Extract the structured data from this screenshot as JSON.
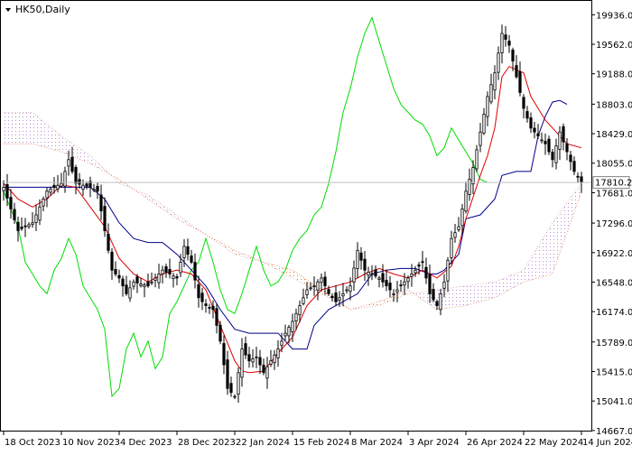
{
  "chart_title": "HK50,Daily",
  "chart_data": {
    "type": "candlestick",
    "symbol": "HK50",
    "timeframe": "Daily",
    "indicator": "Ichimoku Kinko Hyo",
    "current_price": 17810.2,
    "current_price_label": "17810.2",
    "y_range": [
      14677,
      20100
    ],
    "y_ticks": [
      {
        "label": "19936.0",
        "value": 19936.0
      },
      {
        "label": "19562.0",
        "value": 19562.0
      },
      {
        "label": "19188.0",
        "value": 19188.0
      },
      {
        "label": "18803.0",
        "value": 18803.0
      },
      {
        "label": "18429.0",
        "value": 18429.0
      },
      {
        "label": "18055.0",
        "value": 18055.0
      },
      {
        "label": "17681.0",
        "value": 17681.0
      },
      {
        "label": "17296.0",
        "value": 17296.0
      },
      {
        "label": "16922.0",
        "value": 16922.0
      },
      {
        "label": "16548.0",
        "value": 16548.0
      },
      {
        "label": "16174.0",
        "value": 16174.0
      },
      {
        "label": "15789.0",
        "value": 15789.0
      },
      {
        "label": "15415.0",
        "value": 15415.0
      },
      {
        "label": "15041.0",
        "value": 15041.0
      },
      {
        "label": "14667.0",
        "value": 14667.0
      }
    ],
    "x_ticks": [
      {
        "label": "18 Oct 2023",
        "index": 0
      },
      {
        "label": "10 Nov 2023",
        "index": 16
      },
      {
        "label": "4 Dec 2023",
        "index": 32
      },
      {
        "label": "28 Dec 2023",
        "index": 48
      },
      {
        "label": "22 Jan 2024",
        "index": 64
      },
      {
        "label": "15 Feb 2024",
        "index": 80
      },
      {
        "label": "8 Mar 2024",
        "index": 96
      },
      {
        "label": "3 Apr 2024",
        "index": 112
      },
      {
        "label": "26 Apr 2024",
        "index": 128
      },
      {
        "label": "22 May 2024",
        "index": 144
      },
      {
        "label": "14 Jun 2024",
        "index": 160
      }
    ],
    "last_candle_index": 160,
    "series": [
      {
        "name": "close",
        "color": "#000000",
        "points": [
          [
            0,
            17750
          ],
          [
            4,
            17200
          ],
          [
            8,
            17300
          ],
          [
            12,
            17700
          ],
          [
            16,
            17800
          ],
          [
            18,
            18100
          ],
          [
            20,
            17800
          ],
          [
            24,
            17750
          ],
          [
            26,
            17700
          ],
          [
            28,
            17200
          ],
          [
            30,
            16700
          ],
          [
            32,
            16600
          ],
          [
            34,
            16400
          ],
          [
            36,
            16550
          ],
          [
            40,
            16500
          ],
          [
            44,
            16700
          ],
          [
            48,
            16600
          ],
          [
            50,
            17000
          ],
          [
            52,
            16800
          ],
          [
            54,
            16350
          ],
          [
            56,
            16250
          ],
          [
            58,
            16200
          ],
          [
            60,
            15800
          ],
          [
            62,
            15200
          ],
          [
            64,
            15100
          ],
          [
            66,
            15700
          ],
          [
            68,
            15550
          ],
          [
            70,
            15600
          ],
          [
            72,
            15400
          ],
          [
            74,
            15550
          ],
          [
            76,
            15700
          ],
          [
            78,
            15900
          ],
          [
            80,
            16050
          ],
          [
            84,
            16450
          ],
          [
            86,
            16500
          ],
          [
            88,
            16600
          ],
          [
            90,
            16400
          ],
          [
            92,
            16300
          ],
          [
            96,
            16500
          ],
          [
            98,
            16950
          ],
          [
            100,
            16700
          ],
          [
            104,
            16600
          ],
          [
            108,
            16400
          ],
          [
            112,
            16600
          ],
          [
            116,
            16800
          ],
          [
            118,
            16400
          ],
          [
            120,
            16250
          ],
          [
            122,
            16550
          ],
          [
            124,
            17100
          ],
          [
            126,
            17250
          ],
          [
            128,
            17700
          ],
          [
            130,
            18000
          ],
          [
            132,
            18450
          ],
          [
            134,
            18900
          ],
          [
            136,
            19200
          ],
          [
            138,
            19700
          ],
          [
            140,
            19550
          ],
          [
            142,
            19150
          ],
          [
            144,
            18750
          ],
          [
            146,
            18500
          ],
          [
            148,
            18400
          ],
          [
            150,
            18300
          ],
          [
            152,
            18100
          ],
          [
            154,
            18450
          ],
          [
            156,
            18200
          ],
          [
            158,
            17950
          ],
          [
            160,
            17810
          ]
        ]
      },
      {
        "name": "tenkan",
        "color": "#dd0000",
        "points": [
          [
            0,
            17800
          ],
          [
            4,
            17600
          ],
          [
            8,
            17500
          ],
          [
            12,
            17600
          ],
          [
            16,
            17780
          ],
          [
            20,
            17750
          ],
          [
            24,
            17500
          ],
          [
            28,
            17250
          ],
          [
            32,
            16850
          ],
          [
            36,
            16650
          ],
          [
            40,
            16550
          ],
          [
            44,
            16650
          ],
          [
            48,
            16700
          ],
          [
            52,
            16650
          ],
          [
            56,
            16450
          ],
          [
            60,
            16000
          ],
          [
            64,
            15550
          ],
          [
            66,
            15420
          ],
          [
            68,
            15400
          ],
          [
            72,
            15420
          ],
          [
            76,
            15650
          ],
          [
            80,
            15850
          ],
          [
            84,
            16250
          ],
          [
            88,
            16450
          ],
          [
            92,
            16500
          ],
          [
            96,
            16550
          ],
          [
            100,
            16650
          ],
          [
            104,
            16720
          ],
          [
            108,
            16650
          ],
          [
            112,
            16600
          ],
          [
            116,
            16700
          ],
          [
            120,
            16600
          ],
          [
            124,
            16750
          ],
          [
            126,
            17000
          ],
          [
            128,
            17350
          ],
          [
            132,
            17900
          ],
          [
            134,
            18150
          ],
          [
            136,
            18500
          ],
          [
            138,
            19150
          ],
          [
            140,
            19280
          ],
          [
            144,
            19200
          ],
          [
            146,
            18900
          ],
          [
            150,
            18600
          ],
          [
            154,
            18400
          ],
          [
            156,
            18300
          ],
          [
            160,
            18250
          ]
        ]
      },
      {
        "name": "kijun",
        "color": "#00008b",
        "points": [
          [
            0,
            17750
          ],
          [
            14,
            17750
          ],
          [
            24,
            17750
          ],
          [
            28,
            17600
          ],
          [
            32,
            17300
          ],
          [
            36,
            17100
          ],
          [
            40,
            17050
          ],
          [
            44,
            17050
          ],
          [
            48,
            16900
          ],
          [
            52,
            16700
          ],
          [
            56,
            16500
          ],
          [
            60,
            16200
          ],
          [
            64,
            15950
          ],
          [
            68,
            15900
          ],
          [
            72,
            15900
          ],
          [
            76,
            15900
          ],
          [
            80,
            15700
          ],
          [
            84,
            15700
          ],
          [
            86,
            16000
          ],
          [
            90,
            16200
          ],
          [
            94,
            16300
          ],
          [
            98,
            16400
          ],
          [
            102,
            16650
          ],
          [
            106,
            16700
          ],
          [
            110,
            16720
          ],
          [
            114,
            16720
          ],
          [
            118,
            16650
          ],
          [
            120,
            16650
          ],
          [
            122,
            16700
          ],
          [
            124,
            16800
          ],
          [
            126,
            16900
          ],
          [
            128,
            17350
          ],
          [
            132,
            17400
          ],
          [
            136,
            17600
          ],
          [
            138,
            17900
          ],
          [
            142,
            17950
          ],
          [
            146,
            17950
          ],
          [
            148,
            18400
          ],
          [
            150,
            18650
          ],
          [
            152,
            18830
          ],
          [
            154,
            18850
          ],
          [
            156,
            18800
          ]
        ]
      },
      {
        "name": "chikou",
        "color": "#00dd00",
        "points": [
          [
            0,
            17700
          ],
          [
            4,
            17250
          ],
          [
            6,
            16800
          ],
          [
            8,
            16650
          ],
          [
            10,
            16500
          ],
          [
            12,
            16400
          ],
          [
            14,
            16700
          ],
          [
            16,
            16850
          ],
          [
            18,
            17100
          ],
          [
            20,
            16900
          ],
          [
            22,
            16500
          ],
          [
            24,
            16350
          ],
          [
            26,
            16200
          ],
          [
            28,
            15950
          ],
          [
            30,
            15100
          ],
          [
            32,
            15200
          ],
          [
            34,
            15700
          ],
          [
            36,
            15900
          ],
          [
            38,
            15600
          ],
          [
            40,
            15800
          ],
          [
            42,
            15450
          ],
          [
            44,
            15600
          ],
          [
            46,
            16150
          ],
          [
            48,
            16300
          ],
          [
            50,
            16500
          ],
          [
            52,
            16700
          ],
          [
            54,
            16800
          ],
          [
            56,
            17100
          ],
          [
            58,
            16800
          ],
          [
            60,
            16450
          ],
          [
            62,
            16200
          ],
          [
            64,
            16150
          ],
          [
            66,
            16400
          ],
          [
            68,
            16700
          ],
          [
            70,
            17000
          ],
          [
            72,
            16700
          ],
          [
            74,
            16500
          ],
          [
            76,
            16550
          ],
          [
            78,
            16700
          ],
          [
            80,
            16950
          ],
          [
            82,
            17100
          ],
          [
            84,
            17200
          ],
          [
            86,
            17400
          ],
          [
            88,
            17500
          ],
          [
            90,
            17800
          ],
          [
            92,
            18200
          ],
          [
            94,
            18700
          ],
          [
            96,
            19000
          ],
          [
            98,
            19400
          ],
          [
            100,
            19700
          ],
          [
            102,
            19900
          ],
          [
            104,
            19600
          ],
          [
            106,
            19300
          ],
          [
            108,
            19000
          ],
          [
            110,
            18800
          ],
          [
            112,
            18700
          ],
          [
            114,
            18600
          ],
          [
            116,
            18550
          ],
          [
            118,
            18400
          ],
          [
            120,
            18150
          ],
          [
            122,
            18250
          ],
          [
            124,
            18500
          ],
          [
            126,
            18350
          ],
          [
            128,
            18200
          ],
          [
            130,
            18050
          ],
          [
            132,
            17850
          ],
          [
            134,
            17810
          ]
        ]
      },
      {
        "name": "senkou_span_a",
        "color": "#d4a0a0",
        "points": [
          [
            0,
            18700
          ],
          [
            8,
            18700
          ],
          [
            16,
            18400
          ],
          [
            24,
            18150
          ],
          [
            32,
            17800
          ],
          [
            40,
            17650
          ],
          [
            48,
            17400
          ],
          [
            56,
            17150
          ],
          [
            64,
            16900
          ],
          [
            72,
            16800
          ],
          [
            80,
            16600
          ],
          [
            88,
            16400
          ],
          [
            96,
            16200
          ],
          [
            104,
            16250
          ],
          [
            112,
            16400
          ],
          [
            120,
            16450
          ],
          [
            128,
            16500
          ],
          [
            136,
            16550
          ],
          [
            144,
            16700
          ],
          [
            152,
            17300
          ],
          [
            160,
            17800
          ]
        ]
      },
      {
        "name": "senkou_span_b",
        "color": "#e08060",
        "points": [
          [
            0,
            18300
          ],
          [
            8,
            18300
          ],
          [
            16,
            18200
          ],
          [
            24,
            18050
          ],
          [
            32,
            17850
          ],
          [
            40,
            17600
          ],
          [
            48,
            17350
          ],
          [
            56,
            17150
          ],
          [
            64,
            16950
          ],
          [
            72,
            16800
          ],
          [
            80,
            16700
          ],
          [
            88,
            16450
          ],
          [
            96,
            16200
          ],
          [
            104,
            16300
          ],
          [
            112,
            16450
          ],
          [
            120,
            16200
          ],
          [
            128,
            16250
          ],
          [
            136,
            16350
          ],
          [
            144,
            16550
          ],
          [
            152,
            16650
          ],
          [
            160,
            17700
          ]
        ]
      }
    ]
  }
}
